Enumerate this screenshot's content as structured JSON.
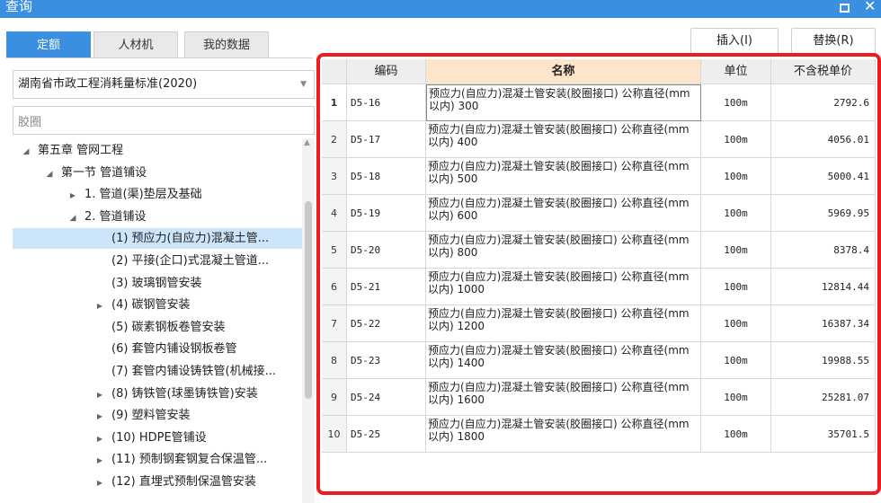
{
  "window": {
    "title": "查询",
    "restore_label": "",
    "close_label": "✕"
  },
  "tabs": [
    {
      "label": "定额",
      "active": true
    },
    {
      "label": "人材机",
      "active": false
    },
    {
      "label": "我的数据",
      "active": false
    }
  ],
  "library": {
    "selected": "湖南省市政工程消耗量标准(2020)"
  },
  "search": {
    "value": "胶圈",
    "placeholder": ""
  },
  "tree": [
    {
      "indent": 0,
      "arrow": "expanded",
      "label": "第五章 管网工程"
    },
    {
      "indent": 1,
      "arrow": "expanded",
      "label": "第一节 管道铺设"
    },
    {
      "indent": 2,
      "arrow": "collapsed",
      "label": "1. 管道(渠)垫层及基础"
    },
    {
      "indent": 2,
      "arrow": "expanded",
      "label": "2. 管道铺设"
    },
    {
      "indent": 3,
      "arrow": "none",
      "label": "(1) 预应力(自应力)混凝土管...",
      "selected": true
    },
    {
      "indent": 3,
      "arrow": "none",
      "label": "(2) 平接(企口)式混凝土管道..."
    },
    {
      "indent": 3,
      "arrow": "none",
      "label": "(3) 玻璃钢管安装"
    },
    {
      "indent": 3,
      "arrow": "collapsed",
      "label": "(4) 碳钢管安装"
    },
    {
      "indent": 3,
      "arrow": "none",
      "label": "(5) 碳素钢板卷管安装"
    },
    {
      "indent": 3,
      "arrow": "none",
      "label": "(6) 套管内铺设钢板卷管"
    },
    {
      "indent": 3,
      "arrow": "none",
      "label": "(7) 套管内铺设铸铁管(机械接..."
    },
    {
      "indent": 3,
      "arrow": "collapsed",
      "label": "(8) 铸铁管(球墨铸铁管)安装"
    },
    {
      "indent": 3,
      "arrow": "collapsed",
      "label": "(9) 塑料管安装"
    },
    {
      "indent": 3,
      "arrow": "collapsed",
      "label": "(10) HDPE管铺设"
    },
    {
      "indent": 3,
      "arrow": "collapsed",
      "label": "(11) 预制钢套钢复合保温管..."
    },
    {
      "indent": 3,
      "arrow": "collapsed",
      "label": "(12) 直埋式预制保温管安装"
    }
  ],
  "buttons": {
    "insert": "插入(I)",
    "replace": "替换(R)"
  },
  "table": {
    "columns": [
      "编码",
      "名称",
      "单位",
      "不含税单价"
    ],
    "rows": [
      {
        "no": "1",
        "code": "D5-16",
        "name": "预应力(自应力)混凝土管安装(胶圈接口) 公称直径(mm以内) 300",
        "unit": "100m",
        "price": "2792.6",
        "selected": true
      },
      {
        "no": "2",
        "code": "D5-17",
        "name": "预应力(自应力)混凝土管安装(胶圈接口) 公称直径(mm以内) 400",
        "unit": "100m",
        "price": "4056.01"
      },
      {
        "no": "3",
        "code": "D5-18",
        "name": "预应力(自应力)混凝土管安装(胶圈接口) 公称直径(mm以内) 500",
        "unit": "100m",
        "price": "5000.41"
      },
      {
        "no": "4",
        "code": "D5-19",
        "name": "预应力(自应力)混凝土管安装(胶圈接口) 公称直径(mm以内) 600",
        "unit": "100m",
        "price": "5969.95"
      },
      {
        "no": "5",
        "code": "D5-20",
        "name": "预应力(自应力)混凝土管安装(胶圈接口) 公称直径(mm以内) 800",
        "unit": "100m",
        "price": "8378.4"
      },
      {
        "no": "6",
        "code": "D5-21",
        "name": "预应力(自应力)混凝土管安装(胶圈接口) 公称直径(mm以内) 1000",
        "unit": "100m",
        "price": "12814.44"
      },
      {
        "no": "7",
        "code": "D5-22",
        "name": "预应力(自应力)混凝土管安装(胶圈接口) 公称直径(mm以内) 1200",
        "unit": "100m",
        "price": "16387.34"
      },
      {
        "no": "8",
        "code": "D5-23",
        "name": "预应力(自应力)混凝土管安装(胶圈接口) 公称直径(mm以内) 1400",
        "unit": "100m",
        "price": "19988.55"
      },
      {
        "no": "9",
        "code": "D5-24",
        "name": "预应力(自应力)混凝土管安装(胶圈接口) 公称直径(mm以内) 1600",
        "unit": "100m",
        "price": "25281.07"
      },
      {
        "no": "10",
        "code": "D5-25",
        "name": "预应力(自应力)混凝土管安装(胶圈接口) 公称直径(mm以内) 1800",
        "unit": "100m",
        "price": "35701.5"
      }
    ]
  },
  "colors": {
    "accent": "#3b8fe0",
    "highlight_border": "#ee1c1c",
    "selected_tree": "#cde5fb",
    "name_header": "#fce5cb"
  }
}
